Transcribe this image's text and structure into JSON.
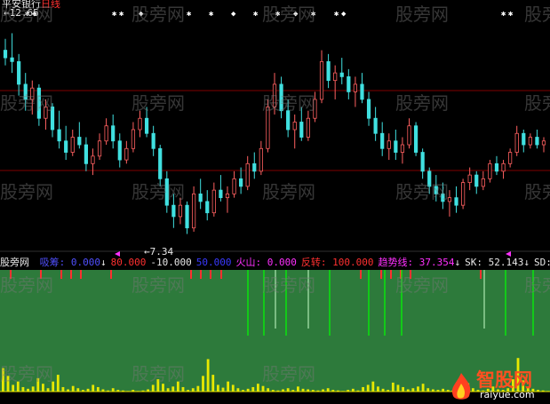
{
  "chart_data": [
    {
      "type": "candlestick",
      "title": "平安银行日线",
      "ticker": "平安银行",
      "period_label": "日线",
      "high_label": "12.65",
      "low_label": "7.34",
      "price_range": [
        7.0,
        13.2
      ],
      "grid": true,
      "candles": [
        [
          12.2,
          12.5,
          11.8,
          12.0
        ],
        [
          12.0,
          12.65,
          11.6,
          11.9
        ],
        [
          11.9,
          12.1,
          11.0,
          11.3
        ],
        [
          11.3,
          11.6,
          10.6,
          10.9
        ],
        [
          10.9,
          11.4,
          10.5,
          11.2
        ],
        [
          11.2,
          11.3,
          10.2,
          10.4
        ],
        [
          10.4,
          10.9,
          10.1,
          10.7
        ],
        [
          10.7,
          10.8,
          9.9,
          10.1
        ],
        [
          10.1,
          10.6,
          9.6,
          9.8
        ],
        [
          9.8,
          10.2,
          9.3,
          9.5
        ],
        [
          9.5,
          10.1,
          9.4,
          9.9
        ],
        [
          9.9,
          10.3,
          9.6,
          9.7
        ],
        [
          9.7,
          9.9,
          9.0,
          9.2
        ],
        [
          9.2,
          9.6,
          8.9,
          9.4
        ],
        [
          9.4,
          10.0,
          9.3,
          9.8
        ],
        [
          9.8,
          10.4,
          9.7,
          10.2
        ],
        [
          10.2,
          10.5,
          9.6,
          9.8
        ],
        [
          9.8,
          10.0,
          9.1,
          9.3
        ],
        [
          9.3,
          9.8,
          9.2,
          9.6
        ],
        [
          9.6,
          10.3,
          9.5,
          10.1
        ],
        [
          10.1,
          10.6,
          9.9,
          10.4
        ],
        [
          10.4,
          10.7,
          9.9,
          10.0
        ],
        [
          10.0,
          10.2,
          9.4,
          9.6
        ],
        [
          9.6,
          9.7,
          8.6,
          8.8
        ],
        [
          8.8,
          9.0,
          7.9,
          8.1
        ],
        [
          8.1,
          8.4,
          7.5,
          7.8
        ],
        [
          7.8,
          8.3,
          7.6,
          8.1
        ],
        [
          8.1,
          8.2,
          7.34,
          7.5
        ],
        [
          7.5,
          8.6,
          7.4,
          8.4
        ],
        [
          8.4,
          8.8,
          8.0,
          8.2
        ],
        [
          8.2,
          8.5,
          7.7,
          7.9
        ],
        [
          7.9,
          8.7,
          7.8,
          8.5
        ],
        [
          8.5,
          8.9,
          8.2,
          8.3
        ],
        [
          8.3,
          8.6,
          7.9,
          8.4
        ],
        [
          8.4,
          9.0,
          8.3,
          8.8
        ],
        [
          8.8,
          9.1,
          8.4,
          8.6
        ],
        [
          8.6,
          9.4,
          8.5,
          9.2
        ],
        [
          9.2,
          9.5,
          8.8,
          9.0
        ],
        [
          9.0,
          9.8,
          8.9,
          9.6
        ],
        [
          9.6,
          10.9,
          9.5,
          10.7
        ],
        [
          10.7,
          11.6,
          10.5,
          11.3
        ],
        [
          11.3,
          11.5,
          10.4,
          10.6
        ],
        [
          10.6,
          10.9,
          9.9,
          10.1
        ],
        [
          10.1,
          10.5,
          9.6,
          10.3
        ],
        [
          10.3,
          10.7,
          9.8,
          9.9
        ],
        [
          9.9,
          10.6,
          9.8,
          10.4
        ],
        [
          10.4,
          11.1,
          10.3,
          10.9
        ],
        [
          10.9,
          12.2,
          10.8,
          11.9
        ],
        [
          11.9,
          12.1,
          11.2,
          11.4
        ],
        [
          11.4,
          11.8,
          10.9,
          11.6
        ],
        [
          11.6,
          12.0,
          11.3,
          11.5
        ],
        [
          11.5,
          11.7,
          10.9,
          11.1
        ],
        [
          11.1,
          11.5,
          10.7,
          11.3
        ],
        [
          11.3,
          11.6,
          10.8,
          10.9
        ],
        [
          10.9,
          11.1,
          10.2,
          10.4
        ],
        [
          10.4,
          10.7,
          9.8,
          10.0
        ],
        [
          10.0,
          10.3,
          9.4,
          9.6
        ],
        [
          9.6,
          10.0,
          9.3,
          9.8
        ],
        [
          9.8,
          10.1,
          9.3,
          9.5
        ],
        [
          9.5,
          9.9,
          9.2,
          9.7
        ],
        [
          9.7,
          10.4,
          9.6,
          10.2
        ],
        [
          10.2,
          10.3,
          9.4,
          9.5
        ],
        [
          9.5,
          9.6,
          8.8,
          9.0
        ],
        [
          9.0,
          9.1,
          8.4,
          8.6
        ],
        [
          8.6,
          8.9,
          8.2,
          8.4
        ],
        [
          8.4,
          8.7,
          8.0,
          8.2
        ],
        [
          8.2,
          8.5,
          7.8,
          8.3
        ],
        [
          8.3,
          8.6,
          7.9,
          8.1
        ],
        [
          8.1,
          8.8,
          8.0,
          8.7
        ],
        [
          8.7,
          9.1,
          8.5,
          8.9
        ],
        [
          8.9,
          9.0,
          8.4,
          8.6
        ],
        [
          8.6,
          9.0,
          8.5,
          8.8
        ],
        [
          8.8,
          9.3,
          8.7,
          9.2
        ],
        [
          9.2,
          9.4,
          8.9,
          9.0
        ],
        [
          9.0,
          9.3,
          8.8,
          9.2
        ],
        [
          9.2,
          9.6,
          9.1,
          9.5
        ],
        [
          9.5,
          10.2,
          9.4,
          10.0
        ],
        [
          10.0,
          10.1,
          9.5,
          9.7
        ],
        [
          9.7,
          10.0,
          9.6,
          9.9
        ],
        [
          9.9,
          10.1,
          9.6,
          9.7
        ],
        [
          9.7,
          9.9,
          9.5,
          9.8
        ]
      ]
    },
    {
      "type": "bar",
      "title": "股旁网",
      "indicators": [
        {
          "name": "吸筹",
          "value": "0.000",
          "arrow": "↓",
          "color": "#5050ff"
        },
        {
          "name": "",
          "value": "80.000",
          "arrow": "",
          "color": "#ff3030"
        },
        {
          "name": "",
          "value": "-10.000",
          "arrow": "",
          "color": "#e8e8e8"
        },
        {
          "name": "",
          "value": "50.000",
          "arrow": "",
          "color": "#3a3aff"
        },
        {
          "name": "火山",
          "value": "0.000",
          "arrow": "",
          "color": "#ff30ff"
        },
        {
          "name": "反转",
          "value": "100.000",
          "arrow": "",
          "color": "#ff3030"
        },
        {
          "name": "趋势线",
          "value": "37.354",
          "arrow": "↓",
          "color": "#ff30ff"
        },
        {
          "name": "SK",
          "value": "52.143",
          "arrow": "↓",
          "color": "#e8e8e8"
        },
        {
          "name": "SD",
          "value": "",
          "arrow": "",
          "color": "#e8e8e8"
        }
      ],
      "ylim": [
        0,
        100
      ],
      "volcano_values": [
        42,
        28,
        12,
        18,
        8,
        5,
        9,
        24,
        14,
        6,
        18,
        30,
        8,
        4,
        10,
        6,
        3,
        5,
        12,
        8,
        4,
        2,
        6,
        3,
        2,
        1,
        3,
        1,
        2,
        4,
        12,
        22,
        14,
        6,
        9,
        18,
        8,
        3,
        6,
        10,
        28,
        58,
        30,
        12,
        7,
        18,
        12,
        6,
        3,
        5,
        8,
        14,
        10,
        6,
        3,
        2,
        4,
        6,
        3,
        9,
        5,
        4,
        3,
        2,
        4,
        6,
        3,
        2,
        1,
        3,
        5,
        2,
        8,
        12,
        18,
        9,
        5,
        3,
        16,
        12,
        8,
        4,
        6,
        9,
        14,
        6,
        4,
        3,
        5,
        3,
        2,
        4,
        8,
        15,
        6,
        3,
        2,
        5,
        9,
        4,
        3,
        6,
        22,
        60,
        20,
        8,
        5,
        3,
        2,
        1
      ],
      "reversal_markers": [
        45,
        48,
        52,
        60,
        67,
        70,
        73,
        92,
        97
      ],
      "trend_markers": [
        50,
        56,
        88
      ],
      "accumulate_markers": [
        2,
        3,
        20,
        24,
        37,
        38,
        47,
        48,
        59,
        65,
        66,
        73,
        74,
        83,
        86,
        88
      ]
    }
  ],
  "watermark": "股旁网",
  "brand_logo": {
    "name": "智股网",
    "url_text": "raiyue.com"
  },
  "colors": {
    "panel_green": "#2d7a3b",
    "candle_up": "#ff6060",
    "candle_down": "#40e0e0",
    "grid": "#800000",
    "yellow": "#e8e800",
    "green_line": "#00ff00",
    "red_marker": "#ff3030"
  }
}
